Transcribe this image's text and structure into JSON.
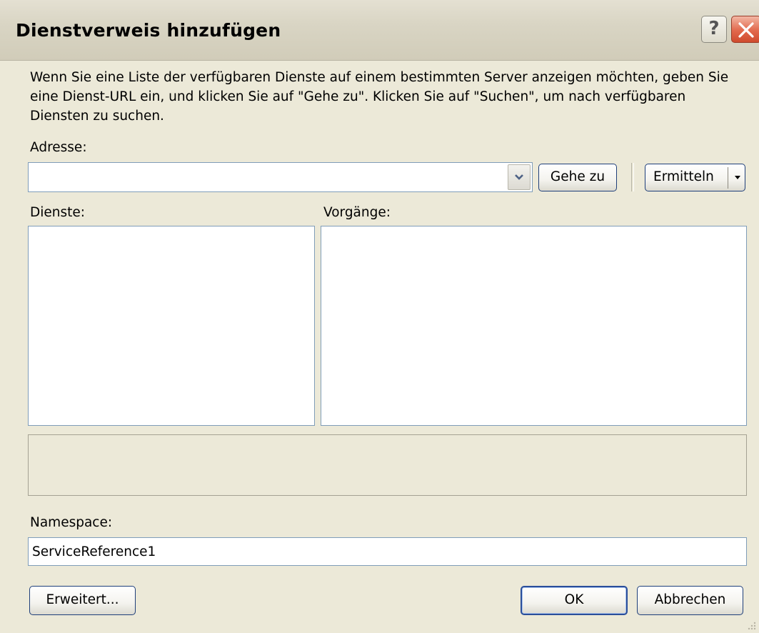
{
  "window": {
    "title": "Dienstverweis hinzufügen",
    "help_glyph": "?"
  },
  "description": "Wenn Sie eine Liste der verfügbaren Dienste auf einem bestimmten Server anzeigen möchten, geben Sie eine Dienst-URL ein, und klicken Sie auf \"Gehe zu\". Klicken Sie auf \"Suchen\", um nach verfügbaren Diensten zu suchen.",
  "address": {
    "label": "Adresse:",
    "value": "",
    "go_label": "Gehe zu",
    "discover_label": "Ermitteln"
  },
  "services": {
    "label": "Dienste:",
    "items": []
  },
  "operations": {
    "label": "Vorgänge:",
    "items": []
  },
  "status": {
    "text": ""
  },
  "namespace": {
    "label": "Namespace:",
    "value": "ServiceReference1"
  },
  "footer": {
    "advanced_label": "Erweitert...",
    "ok_label": "OK",
    "cancel_label": "Abbrechen"
  }
}
